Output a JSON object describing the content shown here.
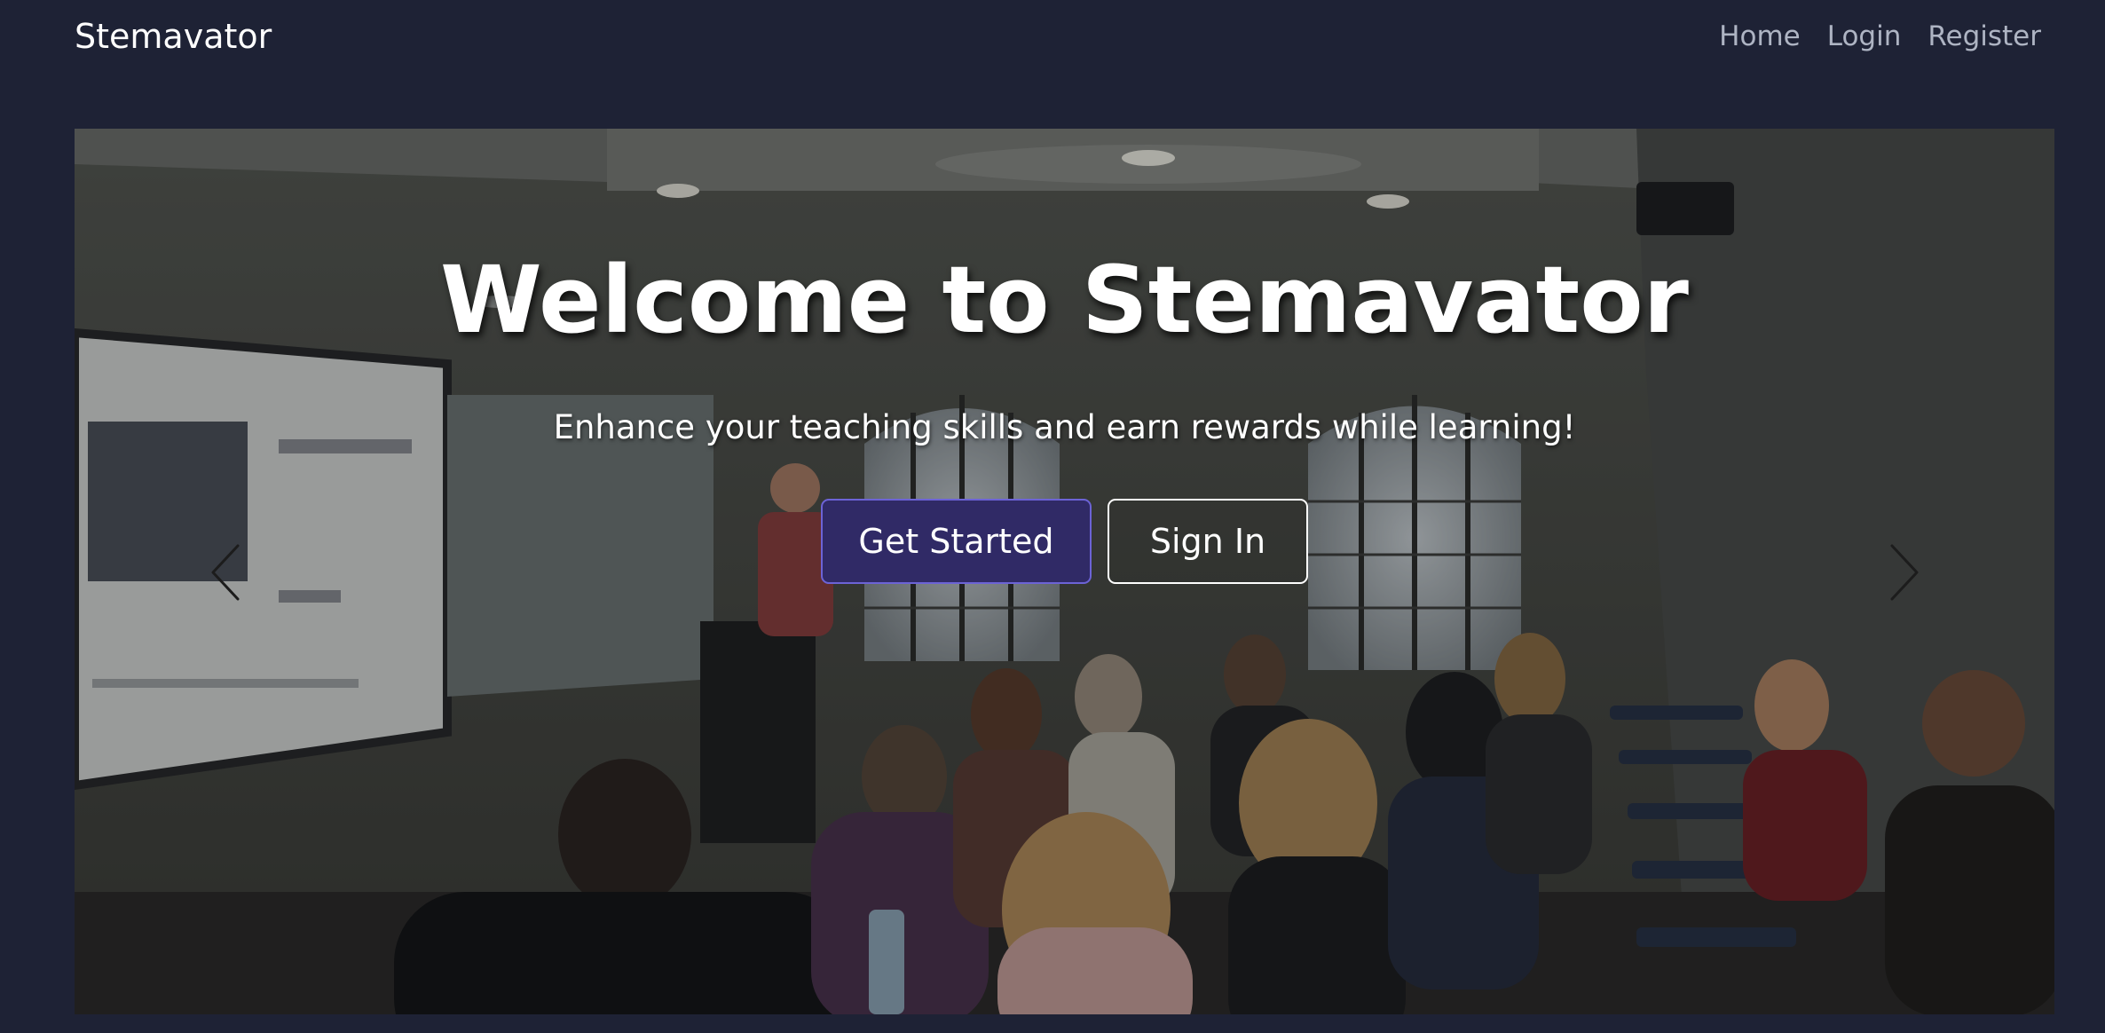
{
  "navbar": {
    "brand": "Stemavator",
    "links": [
      {
        "label": "Home"
      },
      {
        "label": "Login"
      },
      {
        "label": "Register"
      }
    ]
  },
  "hero": {
    "title": "Welcome to Stemavator",
    "subtitle": "Enhance your teaching skills and earn rewards while learning!",
    "primary_button": "Get Started",
    "secondary_button": "Sign In",
    "prev_icon": "chevron-left-icon",
    "next_icon": "chevron-right-icon",
    "image": "classroom-presentation-photo"
  },
  "colors": {
    "background": "#1e2235",
    "nav_link": "#aeb4c3",
    "primary_button_bg": "#302a66",
    "primary_button_border": "#6c63d6"
  }
}
